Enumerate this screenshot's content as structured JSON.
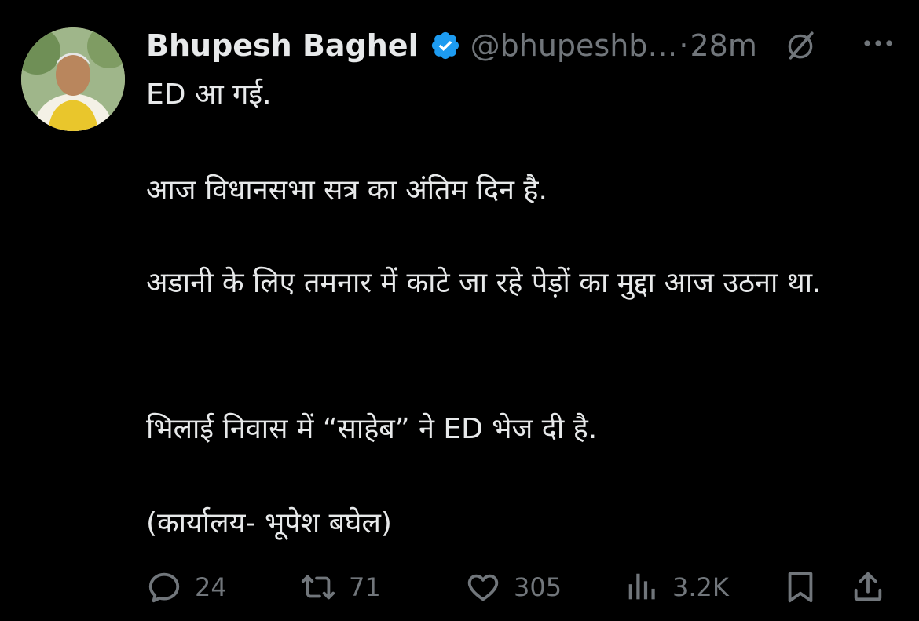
{
  "tweet": {
    "author_name": "Bhupesh Baghel",
    "handle": "@bhupeshb…",
    "separator": "·",
    "time": "28m",
    "lines": {
      "p1": "ED आ गई.",
      "p2": "आज विधानसभा सत्र का अंतिम दिन है.",
      "p3": "अडानी के लिए तमनार में काटे जा रहे पेड़ों का मुद्दा आज उठना था.",
      "p4": "भिलाई निवास में “साहेब” ने ED भेज दी है.",
      "p5": "(कार्यालय- भूपेश बघेल)"
    }
  },
  "actions": {
    "replies": "24",
    "reposts": "71",
    "likes": "305",
    "views": "3.2K"
  },
  "icons": {
    "verified": "verified-badge-icon",
    "grok": "grok-icon",
    "more": "more-icon",
    "reply": "reply-icon",
    "repost": "repost-icon",
    "like": "heart-icon",
    "views": "views-icon",
    "bookmark": "bookmark-icon",
    "share": "share-icon"
  },
  "colors": {
    "background": "#000000",
    "text": "#e7e9ea",
    "muted": "#71767b",
    "verified": "#1d9bf0"
  }
}
